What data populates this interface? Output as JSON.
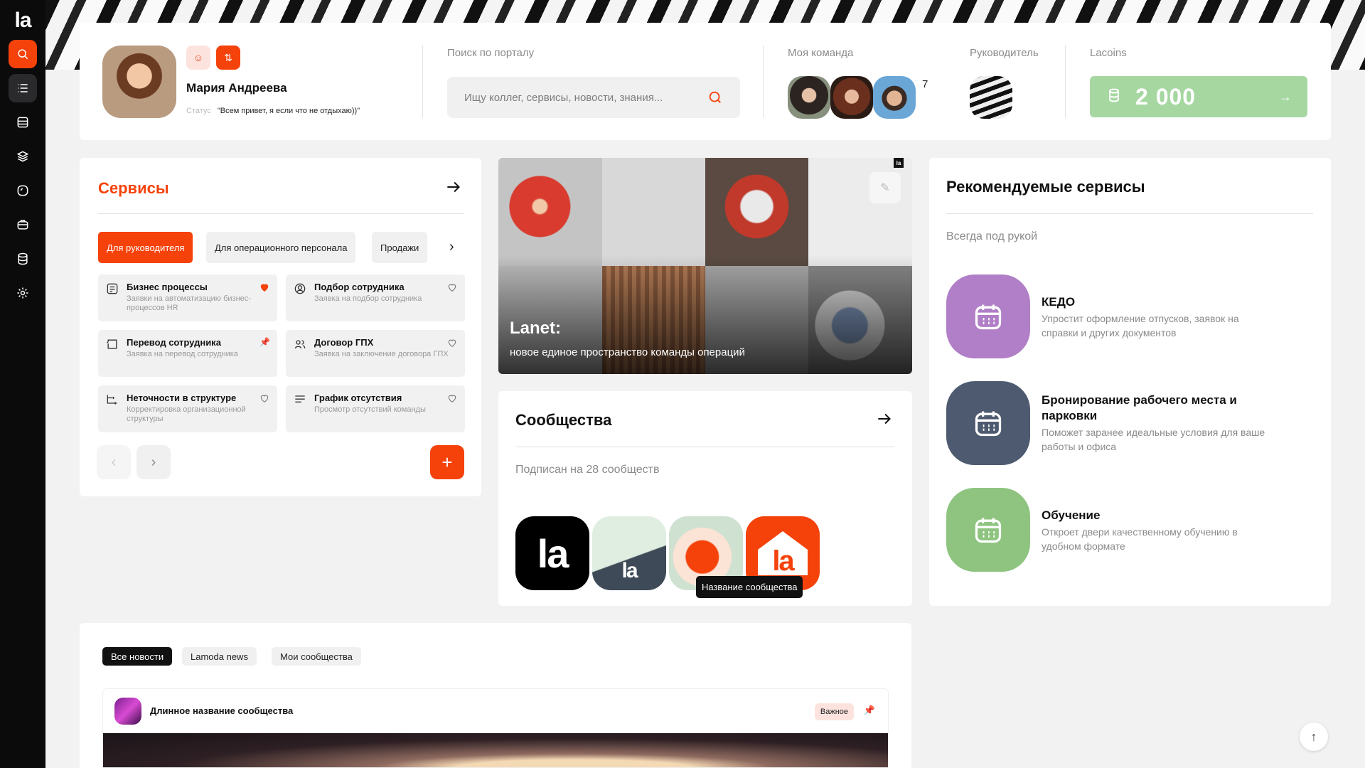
{
  "sidebar": {
    "logo": "la",
    "items": [
      "search-icon",
      "list-icon",
      "inbox-icon",
      "layers-icon",
      "chat-icon",
      "briefcase-icon",
      "database-icon",
      "gear-icon"
    ]
  },
  "profile": {
    "name": "Мария Андреева",
    "status_label": "Статус",
    "status_text": "\"Всем привет, я если что не отдыхаю))\""
  },
  "search": {
    "label": "Поиск по порталу",
    "placeholder": "Ищу коллег, сервисы, новости, знания...",
    "value": ""
  },
  "team": {
    "label": "Моя команда",
    "count": "7"
  },
  "manager": {
    "label": "Руководитель"
  },
  "lacoins": {
    "label": "Lacoins",
    "value": "2 000",
    "color": "#a6d7a1"
  },
  "services": {
    "title": "Сервисы",
    "tabs": [
      "Для руководителя",
      "Для операционного персонала",
      "Продажи"
    ],
    "items": [
      {
        "title": "Бизнес процессы",
        "desc": "Заявки на автоматизацию бизнес-процессов HR",
        "icon": "list-doc-icon",
        "fav": "on"
      },
      {
        "title": "Подбор сотрудника",
        "desc": "Заявка на подбор сотрудника",
        "icon": "person-search-icon",
        "fav": "off"
      },
      {
        "title": "Перевод сотрудника",
        "desc": "Заявка на перевод сотрудника",
        "icon": "transfer-icon",
        "fav": "pin"
      },
      {
        "title": "Договор ГПХ",
        "desc": "Заявка на заключение договора ГПХ",
        "icon": "people-icon",
        "fav": "off"
      },
      {
        "title": "Неточности в структуре",
        "desc": "Корректировка организационной структуры",
        "icon": "structure-icon",
        "fav": "off"
      },
      {
        "title": "График отсутствия",
        "desc": "Просмотр отсутствий команды",
        "icon": "lines-icon",
        "fav": "off"
      }
    ]
  },
  "banner": {
    "title": "Lanet:",
    "subtitle": "новое единое пространство команды операций",
    "logo": "la"
  },
  "communities": {
    "title": "Сообщества",
    "subtitle": "Подписан на 28 сообществ",
    "logo_text_1": "la",
    "logo_text_2": "la",
    "logo_text_3": "la",
    "tooltip": "Название сообщества"
  },
  "recommended": {
    "title": "Рекомендуемые сервисы",
    "subtitle": "Всегда под рукой",
    "items": [
      {
        "title": "КЕДО",
        "desc": "Упростит оформление отпусков, заявок на справки и других документов",
        "color": "#b07fc7"
      },
      {
        "title": "Бронирование рабочего места и парковки",
        "desc": "Поможет заранее идеальные условия для ваше работы и офиса",
        "color": "#4e5a70"
      },
      {
        "title": "Обучение",
        "desc": "Откроет двери качественному обучению в удобном формате",
        "color": "#8ec47f"
      }
    ]
  },
  "news": {
    "tabs": [
      "Все новости",
      "Lamoda news",
      "Мои сообщества"
    ],
    "post": {
      "community": "Длинное название сообщества",
      "badge": "Важное"
    }
  },
  "colors": {
    "accent": "#f5420a",
    "sidebar": "#0b0b0c"
  }
}
